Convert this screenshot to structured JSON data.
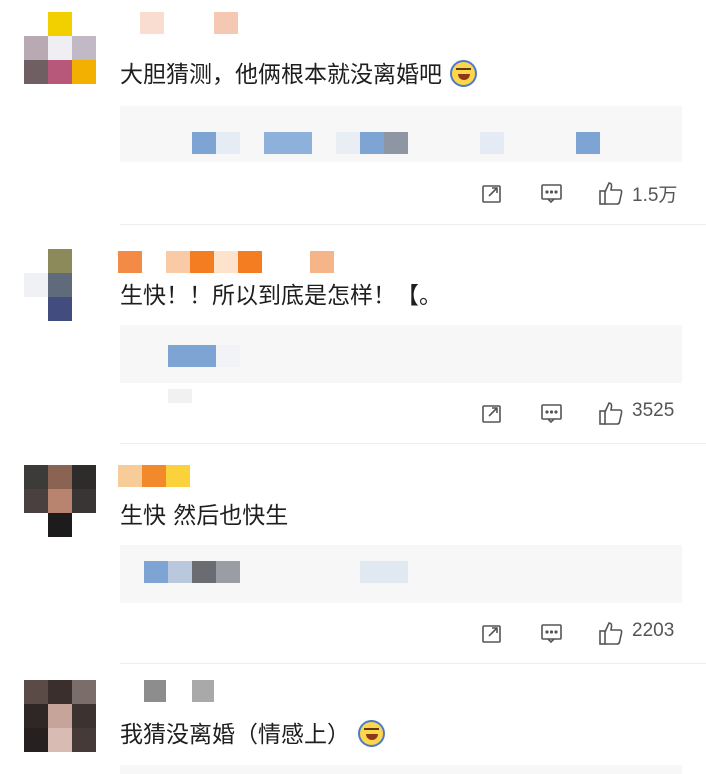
{
  "comments": [
    {
      "text": "大胆猜测，他俩根本就没离婚吧",
      "emoji": "laughing-tears-icon",
      "likes": "1.5万"
    },
    {
      "text": "生快！！所以到底是怎样！【。",
      "likes": "3525"
    },
    {
      "text": "生快  然后也快生",
      "likes": "2203"
    },
    {
      "text": "我猜没离婚（情感上）",
      "emoji": "laughing-tears-icon"
    }
  ],
  "icons": {
    "repost": "repost-icon",
    "comment": "comment-icon",
    "like": "thumbs-up-icon"
  }
}
